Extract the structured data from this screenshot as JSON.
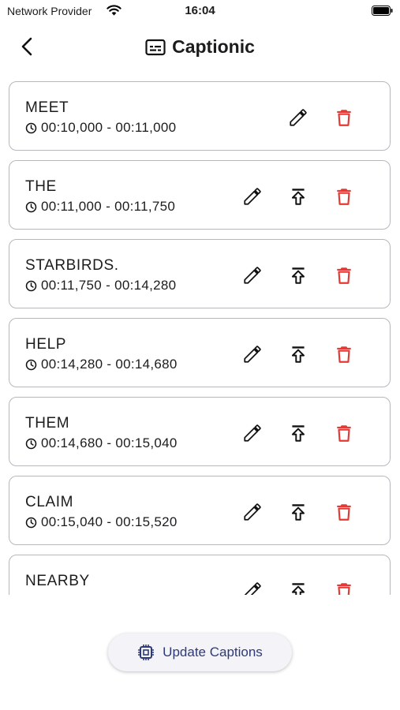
{
  "status_bar": {
    "carrier": "Network Provider",
    "time": "16:04"
  },
  "header": {
    "title": "Captionic"
  },
  "captions": [
    {
      "word": "MEET",
      "time_range": "00:10,000 - 00:11,000",
      "has_merge": false
    },
    {
      "word": "THE",
      "time_range": "00:11,000 - 00:11,750",
      "has_merge": true
    },
    {
      "word": "STARBIRDS.",
      "time_range": "00:11,750 - 00:14,280",
      "has_merge": true
    },
    {
      "word": "HELP",
      "time_range": "00:14,280 - 00:14,680",
      "has_merge": true
    },
    {
      "word": "THEM",
      "time_range": "00:14,680 - 00:15,040",
      "has_merge": true
    },
    {
      "word": "CLAIM",
      "time_range": "00:15,040 - 00:15,520",
      "has_merge": true
    },
    {
      "word": "NEARBY",
      "time_range": "",
      "has_merge": true
    }
  ],
  "footer": {
    "update_label": "Update Captions"
  },
  "colors": {
    "delete": "#e53935",
    "accent": "#2e3a78"
  }
}
